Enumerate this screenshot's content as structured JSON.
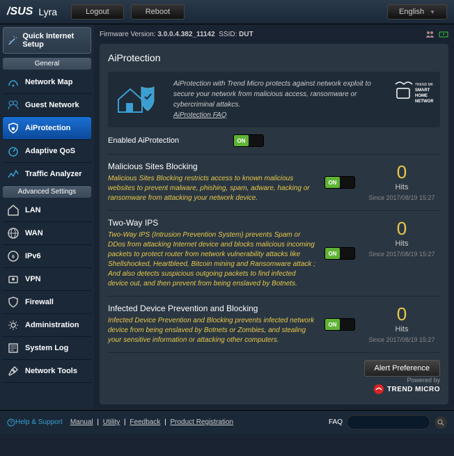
{
  "brand": "/SUS",
  "model": "Lyra",
  "topbar": {
    "logout": "Logout",
    "reboot": "Reboot",
    "language": "English"
  },
  "fw": {
    "label": "Firmware Version:",
    "value": "3.0.0.4.382_11142",
    "ssid_label": "SSID:",
    "ssid": "DUT"
  },
  "sidebar": {
    "quick": "Quick Internet Setup",
    "general_hdr": "General",
    "general": [
      "Network Map",
      "Guest Network",
      "AiProtection",
      "Adaptive QoS",
      "Traffic Analyzer"
    ],
    "advanced_hdr": "Advanced Settings",
    "advanced": [
      "LAN",
      "WAN",
      "IPv6",
      "VPN",
      "Firewall",
      "Administration",
      "System Log",
      "Network Tools"
    ]
  },
  "title": "AiProtection",
  "intro": "AiProtection with Trend Micro protects against network exploit to secure your network from malicious access, ransomware or cybercriminal attakcs.",
  "intro_link": "AiProtection FAQ",
  "tm_badge": "TREND MICRO™ SMART HOME NETWORK",
  "enable_label": "Enabled AiProtection",
  "on_text": "ON",
  "features": [
    {
      "title": "Malicious Sites Blocking",
      "desc": "Malicious Sites Blocking restricts access to known malicious websites to prevent malware, phishing, spam, adware, hacking or ransomware from attacking your network device.",
      "count": "0",
      "hits": "Hits",
      "since": "Since 2017/08/19 15:27"
    },
    {
      "title": "Two-Way IPS",
      "desc": "Two-Way IPS (Intrusion Prevention System) prevents Spam or DDos from attacking Internet device and blocks malicious incoming packets to protect router from network vulnerability attacks like Shellshocked, Heartbleed, Bitcoin mining and Ransomware attack ; And also detects suspicious outgoing packets to find infected device out, and then prevent from being enslaved by Botnets.",
      "count": "0",
      "hits": "Hits",
      "since": "Since 2017/08/19 15:27"
    },
    {
      "title": "Infected Device Prevention and Blocking",
      "desc": "Infected Device Prevention and Blocking prevents infected network device from being enslaved by Botnets or Zombies, and stealing your sensitive information or attacking other computers.",
      "count": "0",
      "hits": "Hits",
      "since": "Since 2017/08/19 15:27"
    }
  ],
  "alert_btn": "Alert Preference",
  "powered": "Powered by",
  "trend": "TREND MICRO",
  "footer": {
    "help": "Help & Support",
    "links": [
      "Manual",
      "Utility",
      "Feedback",
      "Product Registration"
    ],
    "faq": "FAQ"
  }
}
